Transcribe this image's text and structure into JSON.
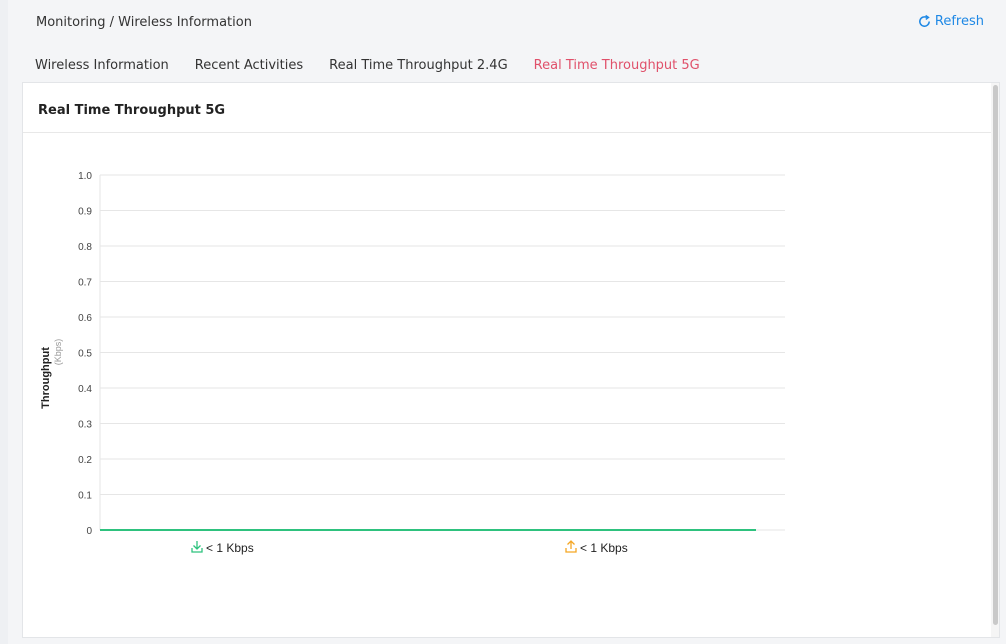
{
  "header": {
    "breadcrumb": "Monitoring / Wireless Information",
    "refresh_label": "Refresh"
  },
  "tabs": [
    {
      "label": "Wireless Information"
    },
    {
      "label": "Recent Activities"
    },
    {
      "label": "Real Time Throughput 2.4G"
    },
    {
      "label": "Real Time Throughput 5G",
      "active": true
    }
  ],
  "panel": {
    "title": "Real Time Throughput 5G"
  },
  "colors": {
    "accent": "#e0506a",
    "refresh": "#1e88e5",
    "download": "#2ec27e",
    "upload": "#f5a623"
  },
  "chart_data": {
    "type": "line",
    "ylabel": "Throughput",
    "yunit": "(Kbps)",
    "ylim": [
      0,
      1.0
    ],
    "yticks": [
      "1.0",
      "0.9",
      "0.8",
      "0.7",
      "0.6",
      "0.5",
      "0.4",
      "0.3",
      "0.2",
      "0.1",
      "0"
    ],
    "grid": true,
    "series": [
      {
        "icon": "download-icon",
        "values": [
          0,
          0
        ]
      }
    ],
    "legend": [
      {
        "icon": "download-icon",
        "text": "< 1 Kbps"
      },
      {
        "icon": "upload-icon",
        "text": "< 1 Kbps"
      }
    ]
  }
}
